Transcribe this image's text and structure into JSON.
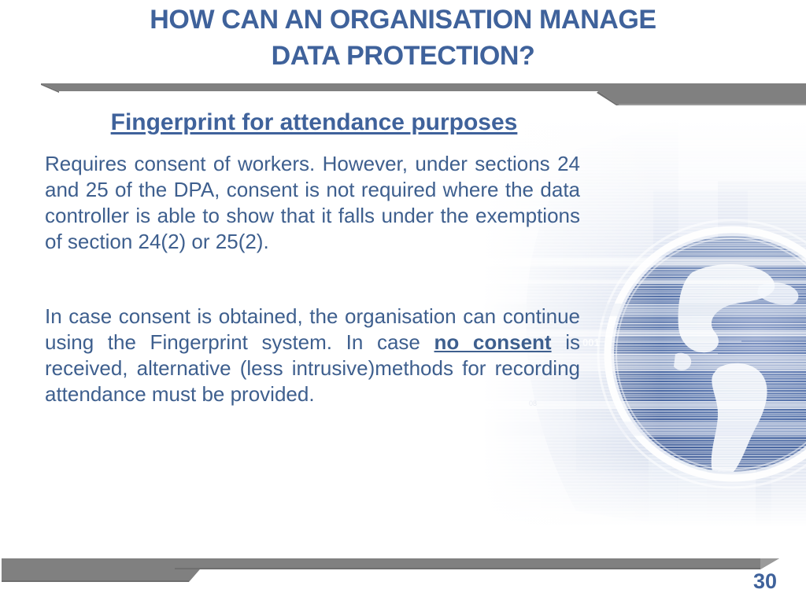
{
  "slide": {
    "title": "HOW CAN AN ORGANISATION MANAGE DATA PROTECTION?",
    "title_line1": "HOW CAN AN ORGANISATION MANAGE",
    "title_line2": "DATA PROTECTION?",
    "subtitle": "Fingerprint for attendance purposes",
    "page_number": "30",
    "body": {
      "paragraph1": "Requires consent of workers. However, under sections 24 and 25 of the DPA, consent is not required where the data controller is able to show that it falls under the exemptions of section 24(2) or 25(2).",
      "paragraph2_part1": "In case consent is obtained, the organisation can continue using the Fingerprint system. In case ",
      "paragraph2_emphasis": "no consent",
      "paragraph2_part2": " is received, alternative (less intrusive)methods for recording attendance must be provided."
    },
    "background_art": {
      "name": "technology-globe-graphic",
      "caption_artifact": "001"
    },
    "colors": {
      "title_blue": "#3f629b",
      "body_blue": "#3e5f8e",
      "band_gray": "#808080",
      "band_gray_dark": "#6f6f6f",
      "globe_blue": "#3f5e9b",
      "page_background": "#ffffff"
    }
  }
}
